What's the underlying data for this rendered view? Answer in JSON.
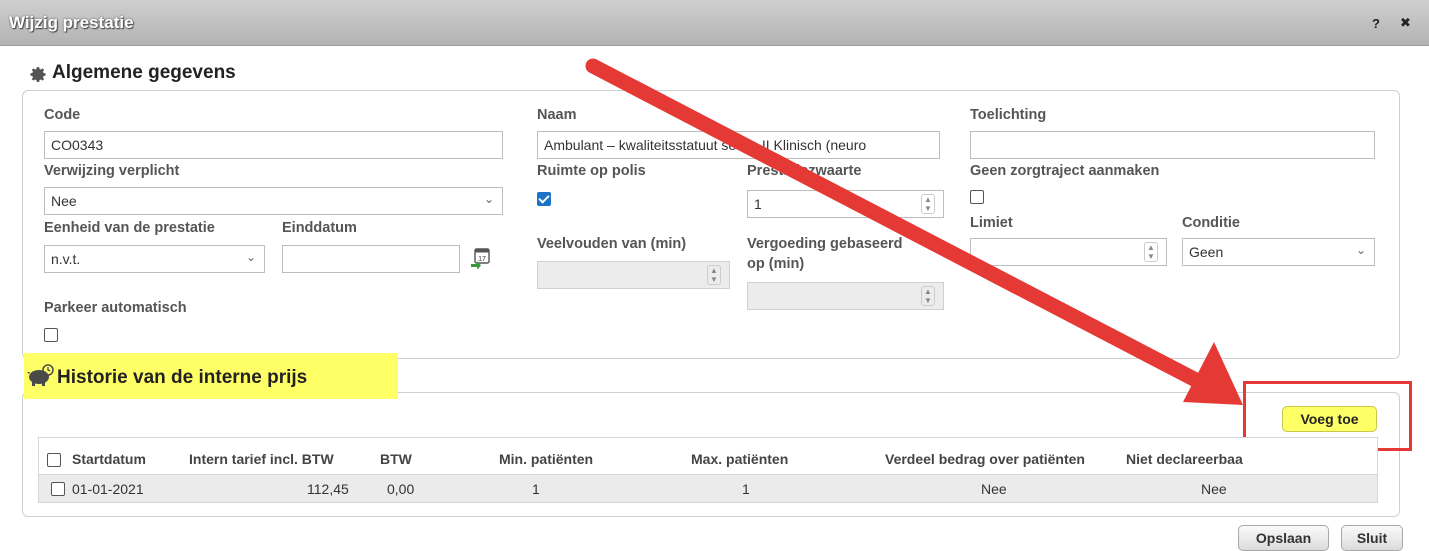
{
  "window": {
    "title": "Wijzig prestatie",
    "help_label": "?",
    "close_label": "✖"
  },
  "general": {
    "title": "Algemene gegevens",
    "code_label": "Code",
    "code_value": "CO0343",
    "naam_label": "Naam",
    "naam_value": "Ambulant – kwaliteitsstatuut sectie II Klinisch (neuro",
    "toelichting_label": "Toelichting",
    "toelichting_value": "",
    "verwijzing_label": "Verwijzing verplicht",
    "verwijzing_value": "Nee",
    "ruimte_label": "Ruimte op polis",
    "ruimte_checked": true,
    "zwaarte_label": "Prestatiezwaarte",
    "zwaarte_value": "1",
    "geen_zorgtraject_label": "Geen zorgtraject aanmaken",
    "geen_zorgtraject_checked": false,
    "eenheid_label": "Eenheid van de prestatie",
    "eenheid_value": "n.v.t.",
    "einddatum_label": "Einddatum",
    "einddatum_value": "",
    "veelvouden_label": "Veelvouden van (min)",
    "veelvouden_value": "",
    "vergoeding_label_1": "Vergoeding gebaseerd",
    "vergoeding_label_2": "op (min)",
    "vergoeding_value": "",
    "limiet_label": "Limiet",
    "limiet_value": "",
    "conditie_label": "Conditie",
    "conditie_value": "Geen",
    "parkeer_label": "Parkeer automatisch",
    "parkeer_checked": false
  },
  "history": {
    "title": "Historie van de interne prijs",
    "add_button": "Voeg toe",
    "columns": [
      "Startdatum",
      "Intern tarief incl. BTW",
      "BTW",
      "Min. patiënten",
      "Max. patiënten",
      "Verdeel bedrag over patiënten",
      "Niet declareerbaa"
    ],
    "rows": [
      {
        "startdatum": "01-01-2021",
        "tarief": "112,45",
        "btw": "0,00",
        "min": "1",
        "max": "1",
        "verdeel": "Nee",
        "niet_declareerbaar": "Nee"
      }
    ]
  },
  "footer": {
    "save_button": "Opslaan",
    "close_button": "Sluit"
  },
  "colors": {
    "annotation_red": "#e53935",
    "highlight_yellow": "#ffff66",
    "checkbox_blue": "#1a73c7"
  }
}
